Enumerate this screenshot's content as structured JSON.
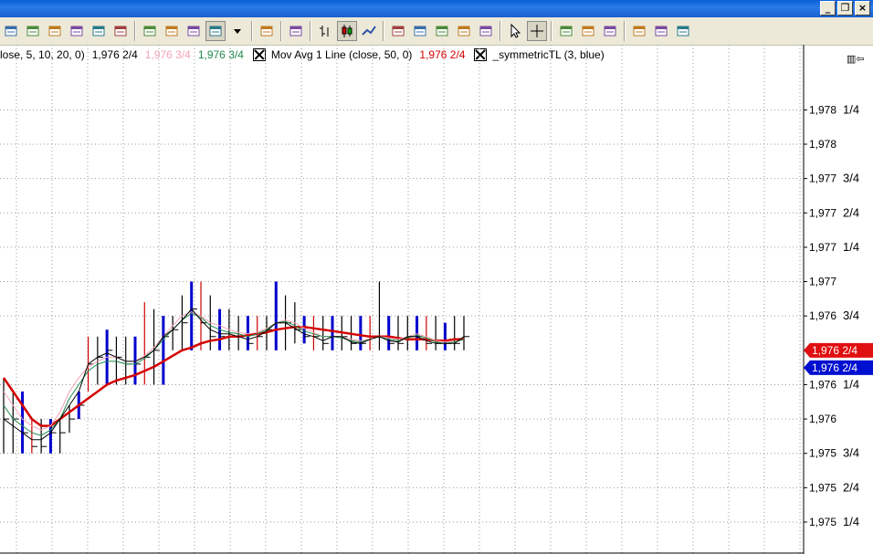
{
  "window": {
    "minimize_glyph": "_",
    "restore_glyph": "❐",
    "close_glyph": "×"
  },
  "toolbar": {
    "groups": [
      [
        "data-series-icon",
        "open-chart-icon",
        "save-template-icon",
        "properties-icon",
        "print-icon",
        "clipboard-icon"
      ],
      [
        "indicators-icon",
        "strategies-icon",
        "drawing-tools-icon",
        "color-icon",
        "dropdown-arrow-icon"
      ],
      [
        "alerts-icon"
      ],
      [
        "chart-window-icon"
      ],
      [
        "bar-chart-icon",
        "candlestick-icon",
        "line-chart-icon"
      ],
      [
        "tick-up-icon",
        "swing-icon",
        "ruler-icon",
        "circle-icon",
        "box-icon"
      ],
      [
        "pointer-icon",
        "crosshair-icon"
      ],
      [
        "insert-icon",
        "delete-icon",
        "move-icon"
      ],
      [
        "panel-icon",
        "zoom-icon",
        "settings-icon"
      ]
    ]
  },
  "legend": {
    "item1_prefix": "lose,  5,  10,  20,  0)",
    "item1_value_black": "1,976 2/4",
    "item1_value_pink": "1,976 3/4",
    "item1_value_green": "1,976 3/4",
    "item2_label": "Mov Avg 1 Line  (close,  50,  0)",
    "item2_value_red": "1,976 2/4",
    "item3_label": "_symmetricTL  (3,  blue)",
    "legend_icon_glyph": "▥⇦",
    "colors": {
      "pink": "#f4a3b4",
      "green": "#1f8a4c",
      "red": "#d40000",
      "blue": "#0000cc"
    }
  },
  "price_axis": {
    "labels": [
      {
        "value": 1978.25,
        "whole": "1,978",
        "frac": "1/4"
      },
      {
        "value": 1978.0,
        "whole": "1,978",
        "frac": ""
      },
      {
        "value": 1977.75,
        "whole": "1,977",
        "frac": "3/4"
      },
      {
        "value": 1977.5,
        "whole": "1,977",
        "frac": "2/4"
      },
      {
        "value": 1977.25,
        "whole": "1,977",
        "frac": "1/4"
      },
      {
        "value": 1977.0,
        "whole": "1,977",
        "frac": ""
      },
      {
        "value": 1976.75,
        "whole": "1,976",
        "frac": "3/4"
      },
      {
        "value": 1976.25,
        "whole": "1,976",
        "frac": "1/4"
      },
      {
        "value": 1976.0,
        "whole": "1,976",
        "frac": ""
      },
      {
        "value": 1975.75,
        "whole": "1,975",
        "frac": "3/4"
      },
      {
        "value": 1975.5,
        "whole": "1,975",
        "frac": "2/4"
      },
      {
        "value": 1975.25,
        "whole": "1,975",
        "frac": "1/4"
      }
    ],
    "tags": [
      {
        "whole": "1,976",
        "frac": "2/4",
        "value": 1976.5,
        "color": "#e01010"
      },
      {
        "whole": "1,976",
        "frac": "2/4",
        "value": 1976.5,
        "color": "#0010d0"
      }
    ]
  },
  "chart_data": {
    "type": "line",
    "y_range": [
      1975.0,
      1978.5
    ],
    "grid": true,
    "bars": {
      "highs": [
        1976.3,
        1976.2,
        1976.2,
        1976.0,
        1976.0,
        1976.0,
        1976.0,
        1976.1,
        1976.2,
        1976.6,
        1976.6,
        1976.65,
        1976.6,
        1976.6,
        1976.6,
        1976.85,
        1976.8,
        1976.75,
        1976.75,
        1976.9,
        1977.0,
        1977.0,
        1976.9,
        1976.8,
        1976.8,
        1976.75,
        1976.75,
        1976.75,
        1976.75,
        1977.0,
        1976.9,
        1976.85,
        1976.75,
        1976.75,
        1976.75,
        1976.75,
        1976.75,
        1976.75,
        1976.75,
        1976.75,
        1977.0,
        1976.75,
        1976.75,
        1976.75,
        1976.75,
        1976.75,
        1976.75,
        1976.7,
        1976.75,
        1976.75
      ],
      "lows": [
        1975.75,
        1975.75,
        1975.75,
        1975.75,
        1975.75,
        1975.75,
        1975.75,
        1975.9,
        1976.0,
        1976.2,
        1976.25,
        1976.25,
        1976.25,
        1976.25,
        1976.25,
        1976.25,
        1976.25,
        1976.25,
        1976.5,
        1976.5,
        1976.5,
        1976.5,
        1976.5,
        1976.5,
        1976.5,
        1976.5,
        1976.5,
        1976.5,
        1976.5,
        1976.5,
        1976.5,
        1976.55,
        1976.55,
        1976.5,
        1976.5,
        1976.5,
        1976.5,
        1976.5,
        1976.5,
        1976.5,
        1976.5,
        1976.5,
        1976.5,
        1976.5,
        1976.5,
        1976.5,
        1976.5,
        1976.5,
        1976.5,
        1976.5
      ],
      "closes": [
        1976.0,
        1976.0,
        1975.9,
        1975.8,
        1975.8,
        1975.9,
        1975.9,
        1976.0,
        1976.1,
        1976.4,
        1976.45,
        1976.5,
        1976.45,
        1976.4,
        1976.4,
        1976.45,
        1976.5,
        1976.6,
        1976.65,
        1976.7,
        1976.8,
        1976.7,
        1976.6,
        1976.6,
        1976.6,
        1976.6,
        1976.55,
        1976.6,
        1976.65,
        1976.7,
        1976.7,
        1976.65,
        1976.6,
        1976.6,
        1976.55,
        1976.6,
        1976.6,
        1976.55,
        1976.55,
        1976.6,
        1976.6,
        1976.55,
        1976.55,
        1976.6,
        1976.6,
        1976.55,
        1976.55,
        1976.55,
        1976.55,
        1976.6
      ]
    },
    "series": [
      {
        "values": [
          1976.3,
          1976.2,
          1976.1,
          1976.0,
          1975.95,
          1975.95,
          1976.0,
          1976.05,
          1976.1,
          1976.15,
          1976.2,
          1976.25,
          1976.28,
          1976.3,
          1976.32,
          1976.35,
          1976.38,
          1976.42,
          1976.46,
          1976.5,
          1976.52,
          1976.55,
          1976.57,
          1976.58,
          1976.6,
          1976.6,
          1976.61,
          1976.62,
          1976.63,
          1976.65,
          1976.66,
          1976.67,
          1976.67,
          1976.66,
          1976.65,
          1976.64,
          1976.63,
          1976.62,
          1976.61,
          1976.6,
          1976.6,
          1976.6,
          1976.59,
          1976.58,
          1976.58,
          1976.58,
          1976.57,
          1976.57,
          1976.58,
          1976.58
        ]
      },
      {
        "values": [
          1976.2,
          1976.1,
          1976.0,
          1975.95,
          1975.92,
          1975.95,
          1976.05,
          1976.2,
          1976.3,
          1976.38,
          1976.42,
          1976.45,
          1976.45,
          1976.42,
          1976.42,
          1976.46,
          1976.52,
          1976.6,
          1976.68,
          1976.75,
          1976.78,
          1976.75,
          1976.7,
          1976.68,
          1976.65,
          1976.63,
          1976.62,
          1976.63,
          1976.66,
          1976.7,
          1976.72,
          1976.7,
          1976.66,
          1976.63,
          1976.6,
          1976.6,
          1976.6,
          1976.58,
          1976.57,
          1976.58,
          1976.6,
          1976.59,
          1976.58,
          1976.6,
          1976.62,
          1976.6,
          1976.57,
          1976.56,
          1976.56,
          1976.58
        ]
      },
      {
        "values": [
          1976.1,
          1976.0,
          1975.95,
          1975.9,
          1975.88,
          1975.92,
          1976.0,
          1976.15,
          1976.25,
          1976.35,
          1976.4,
          1976.42,
          1976.42,
          1976.4,
          1976.4,
          1976.44,
          1976.5,
          1976.58,
          1976.65,
          1976.72,
          1976.77,
          1976.74,
          1976.68,
          1976.65,
          1976.63,
          1976.62,
          1976.6,
          1976.62,
          1976.65,
          1976.7,
          1976.71,
          1976.68,
          1976.64,
          1976.62,
          1976.6,
          1976.6,
          1976.59,
          1976.57,
          1976.56,
          1976.58,
          1976.6,
          1976.58,
          1976.57,
          1976.59,
          1976.61,
          1976.59,
          1976.56,
          1976.55,
          1976.56,
          1976.58
        ]
      },
      {
        "values": [
          1976.0,
          1975.95,
          1975.9,
          1975.85,
          1975.85,
          1975.9,
          1976.0,
          1976.1,
          1976.2,
          1976.4,
          1976.45,
          1976.48,
          1976.45,
          1976.42,
          1976.42,
          1976.45,
          1976.5,
          1976.6,
          1976.65,
          1976.72,
          1976.8,
          1976.72,
          1976.65,
          1976.62,
          1976.62,
          1976.6,
          1976.58,
          1976.6,
          1976.64,
          1976.7,
          1976.7,
          1976.66,
          1976.62,
          1976.6,
          1976.57,
          1976.6,
          1976.6,
          1976.56,
          1976.55,
          1976.58,
          1976.6,
          1976.57,
          1976.56,
          1976.6,
          1976.6,
          1976.57,
          1976.55,
          1976.55,
          1976.55,
          1976.6
        ]
      }
    ]
  }
}
